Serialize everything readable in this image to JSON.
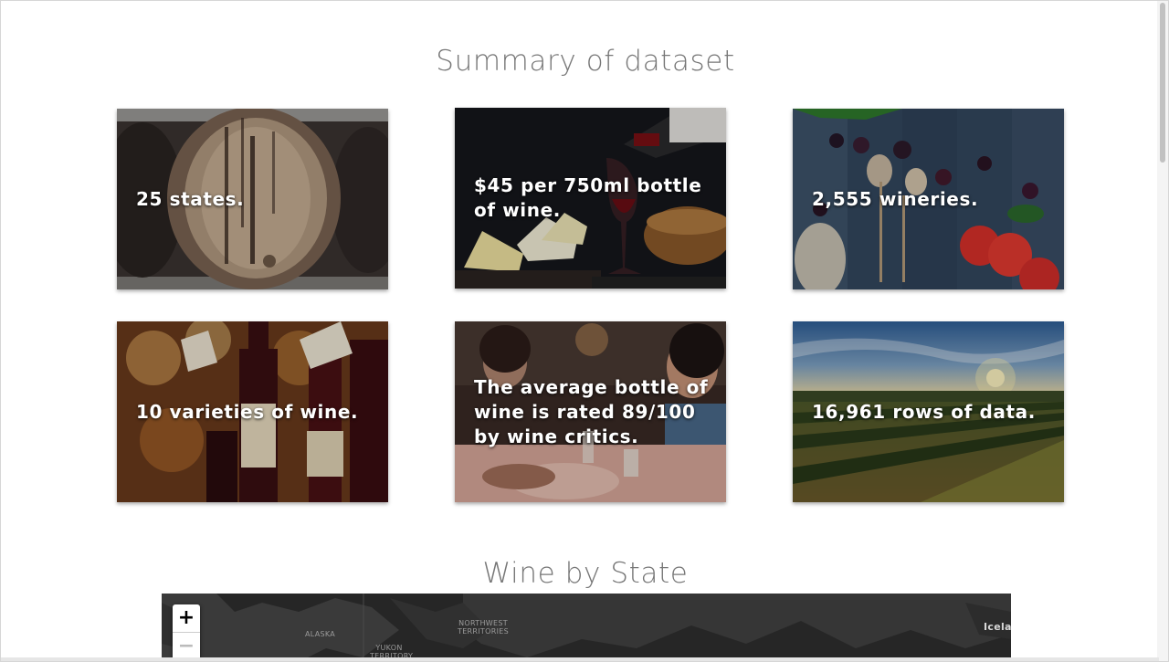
{
  "summary": {
    "title": "Summary of dataset",
    "cards": [
      {
        "caption": "25 states.",
        "image": "wine-barrel-photo"
      },
      {
        "caption": "$45 per 750ml bottle of wine.",
        "image": "wine-pouring-cheese-photo"
      },
      {
        "caption": "2,555 wineries.",
        "image": "berries-roses-photo"
      },
      {
        "caption": "10 varieties of wine.",
        "image": "wine-bottles-tags-photo"
      },
      {
        "caption": "The average bottle of wine is rated 89/100 by wine critics.",
        "image": "people-dining-photo"
      },
      {
        "caption": "16,961 rows of data.",
        "image": "vineyard-sunset-photo"
      }
    ]
  },
  "map_section": {
    "title": "Wine by State",
    "zoom_in_label": "+",
    "zoom_out_label": "−",
    "labels": {
      "alaska": "ALASKA",
      "nwt": "NORTHWEST TERRITORIES",
      "yukon": "YUKON TERRITORY",
      "iceland": "Icelan"
    }
  }
}
